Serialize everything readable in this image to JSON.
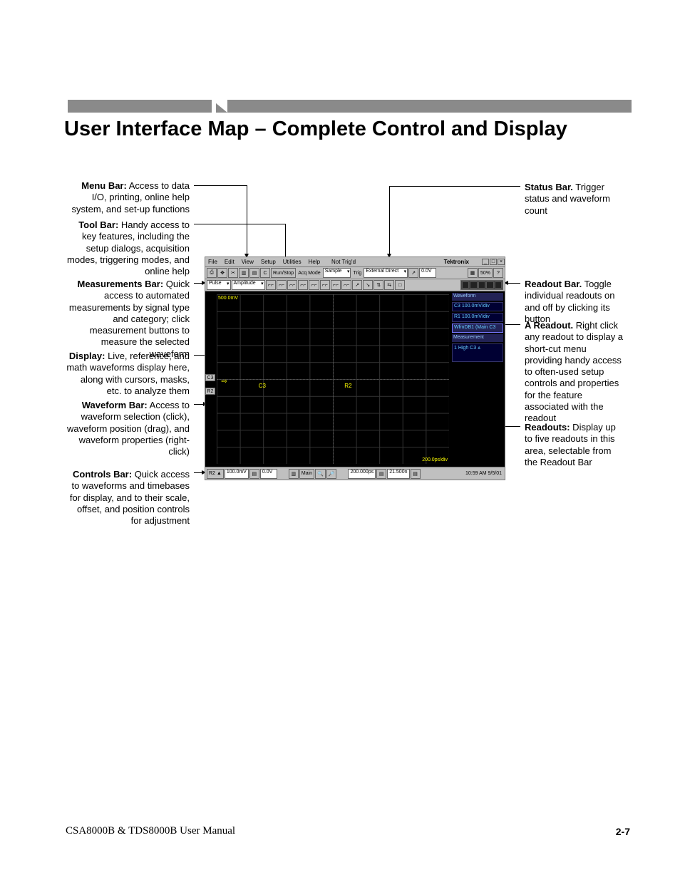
{
  "page_title": "User Interface Map – Complete Control and Display",
  "footer": {
    "left": "CSA8000B & TDS8000B User Manual",
    "right": "2-7"
  },
  "annotations": {
    "menu_bar": {
      "label": "Menu Bar:",
      "text": " Access to data I/O, printing, online help system, and set-up functions"
    },
    "tool_bar": {
      "label": "Tool Bar:",
      "text": " Handy access to key features, including the setup dialogs, acquisition modes, triggering modes, and online help"
    },
    "meas_bar": {
      "label": "Measurements Bar:",
      "text": " Quick access to automated measurements by signal type and category; click measurement buttons to measure the selected waveform"
    },
    "display": {
      "label": "Display:",
      "text": " Live, reference, and math waveforms display here, along with cursors, masks, etc. to analyze them"
    },
    "wave_bar": {
      "label": "Waveform Bar:",
      "text": " Access to waveform selection (click), waveform position (drag), and waveform properties (right-click)"
    },
    "controls_bar": {
      "label": "Controls Bar:",
      "text": " Quick access to waveforms and timebases for display, and to their scale, offset, and position controls for adjustment"
    },
    "status_bar": {
      "label": "Status Bar.",
      "text": " Trigger status and waveform count"
    },
    "readout_bar": {
      "label": "Readout Bar.",
      "text": " Toggle individual readouts on and off by clicking its button"
    },
    "a_readout": {
      "label": "A Readout.",
      "text": " Right click any readout to display a short-cut menu providing handy access to often-used setup controls and properties for the feature associated with the readout"
    },
    "readouts": {
      "label": "Readouts:",
      "text": " Display up to five readouts in this area, selectable from the Readout Bar"
    }
  },
  "screenshot": {
    "menu": {
      "items": [
        "File",
        "Edit",
        "View",
        "Setup",
        "Utilities",
        "Help"
      ],
      "status": "Not Trig'd",
      "brand": "Tektronix"
    },
    "toolbar": {
      "runstop": "Run/Stop",
      "acq_label": "Acq Mode",
      "acq_value": "Sample",
      "trig_label": "Trig",
      "trig_value": "External Direct",
      "trig_level": "0.0V",
      "pct": "50%"
    },
    "measurebar": {
      "type_value": "Pulse",
      "cat_value": "Amplitude",
      "buttons": [
        "⌐⌐",
        "⌐⌐",
        "⌐⌐",
        "⌐⌐",
        "⌐⌐",
        "⌐⌐",
        "⌐⌐",
        "⌐⌐",
        "↗",
        "↘",
        "⇅",
        "⇆",
        "□"
      ]
    },
    "plot": {
      "scale_tl": "500.0mV",
      "scale_br": "200.0ps/div",
      "tags": {
        "c3": "C3",
        "r2": "R2"
      },
      "labels": {
        "c3": "C3",
        "r2": "R2"
      },
      "cursor": "⇨"
    },
    "readouts": {
      "hdr1": "Waveform",
      "r1": "C3  100.0mV/div",
      "r2": "R1  100.0mV/div",
      "r3": "WfmDB1 (Main C3",
      "hdr2": "Measurement",
      "meas1": "1 High   C3   ⩓"
    },
    "controlsbar": {
      "wfm": "R2 ▲",
      "vscale": "100.0mV",
      "vpos": "0.0V",
      "tbase": "Main",
      "hscale": "200.000ps",
      "hpos": "21.500n",
      "time": "10:59 AM 9/5/01"
    }
  }
}
